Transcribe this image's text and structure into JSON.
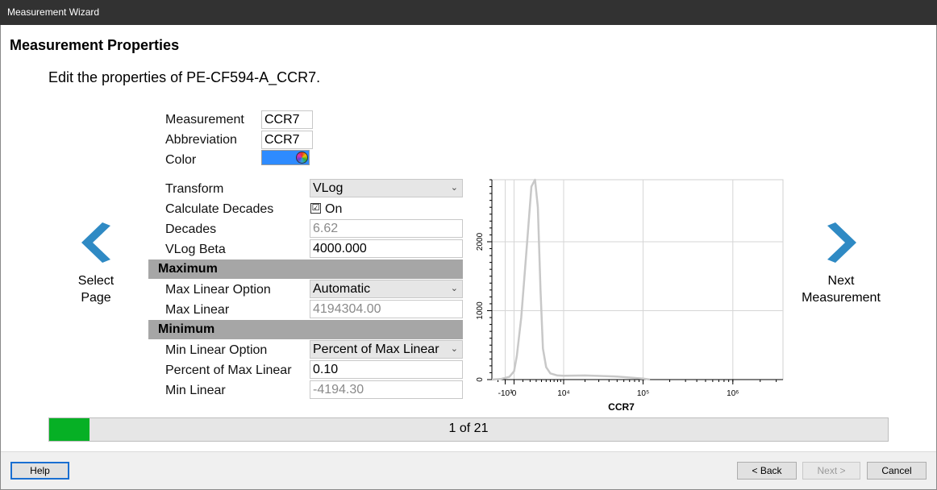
{
  "window": {
    "title": "Measurement Wizard"
  },
  "page": {
    "title": "Measurement Properties",
    "subtitle": "Edit the properties of PE-CF594-A_CCR7."
  },
  "properties": {
    "measurement_label": "Measurement",
    "measurement_value": "CCR7",
    "abbreviation_label": "Abbreviation",
    "abbreviation_value": "CCR7",
    "color_label": "Color",
    "color_value": "#2e8bff",
    "transform_label": "Transform",
    "transform_value": "VLog",
    "calc_decades_label": "Calculate Decades",
    "calc_decades_checked": true,
    "calc_decades_check_glyph": "☑",
    "calc_decades_value": "On",
    "decades_label": "Decades",
    "decades_value": "6.62",
    "vlog_beta_label": "VLog Beta",
    "vlog_beta_value": "4000.000"
  },
  "maximum": {
    "header": "Maximum",
    "option_label": "Max Linear Option",
    "option_value": "Automatic",
    "linear_label": "Max Linear",
    "linear_value": "4194304.00"
  },
  "minimum": {
    "header": "Minimum",
    "option_label": "Min Linear Option",
    "option_value": "Percent of Max Linear",
    "percent_label": "Percent of Max Linear",
    "percent_value": "0.10",
    "linear_label": "Min Linear",
    "linear_value": "-4194.30"
  },
  "nav": {
    "prev_line1": "Select",
    "prev_line2": "Page",
    "next_line1": "Next",
    "next_line2": "Measurement",
    "arrow_color": "#2f8ac4"
  },
  "progress": {
    "text": "1 of 21",
    "current": 1,
    "total": 21,
    "fill_color": "#06b025"
  },
  "buttons": {
    "help": "Help",
    "back": "< Back",
    "next": "Next >",
    "cancel": "Cancel"
  },
  "chart_data": {
    "type": "line",
    "xlabel": "CCR7",
    "ylabel": "",
    "x_ticks": [
      {
        "label": "-10³",
        "pos": -1000
      },
      {
        "label": "0",
        "pos": 0
      },
      {
        "label": "10⁴",
        "pos": 10000
      },
      {
        "label": "10⁵",
        "pos": 100000
      },
      {
        "label": "10⁶",
        "pos": 1000000
      }
    ],
    "y_ticks": [
      0,
      1000,
      2000
    ],
    "ylim": [
      0,
      2900
    ],
    "line_color": "#c8c8c8",
    "series": [
      {
        "x": [
          -3000,
          -1500,
          -500,
          0,
          300,
          800,
          1500,
          2200,
          2800,
          3300,
          3800,
          4300,
          5000,
          6000,
          8000,
          10000,
          20000,
          50000,
          100000,
          120000
        ],
        "y": [
          0,
          10,
          40,
          120,
          350,
          900,
          1900,
          2800,
          2900,
          2500,
          1300,
          450,
          180,
          90,
          60,
          55,
          60,
          45,
          15,
          0
        ]
      }
    ]
  }
}
